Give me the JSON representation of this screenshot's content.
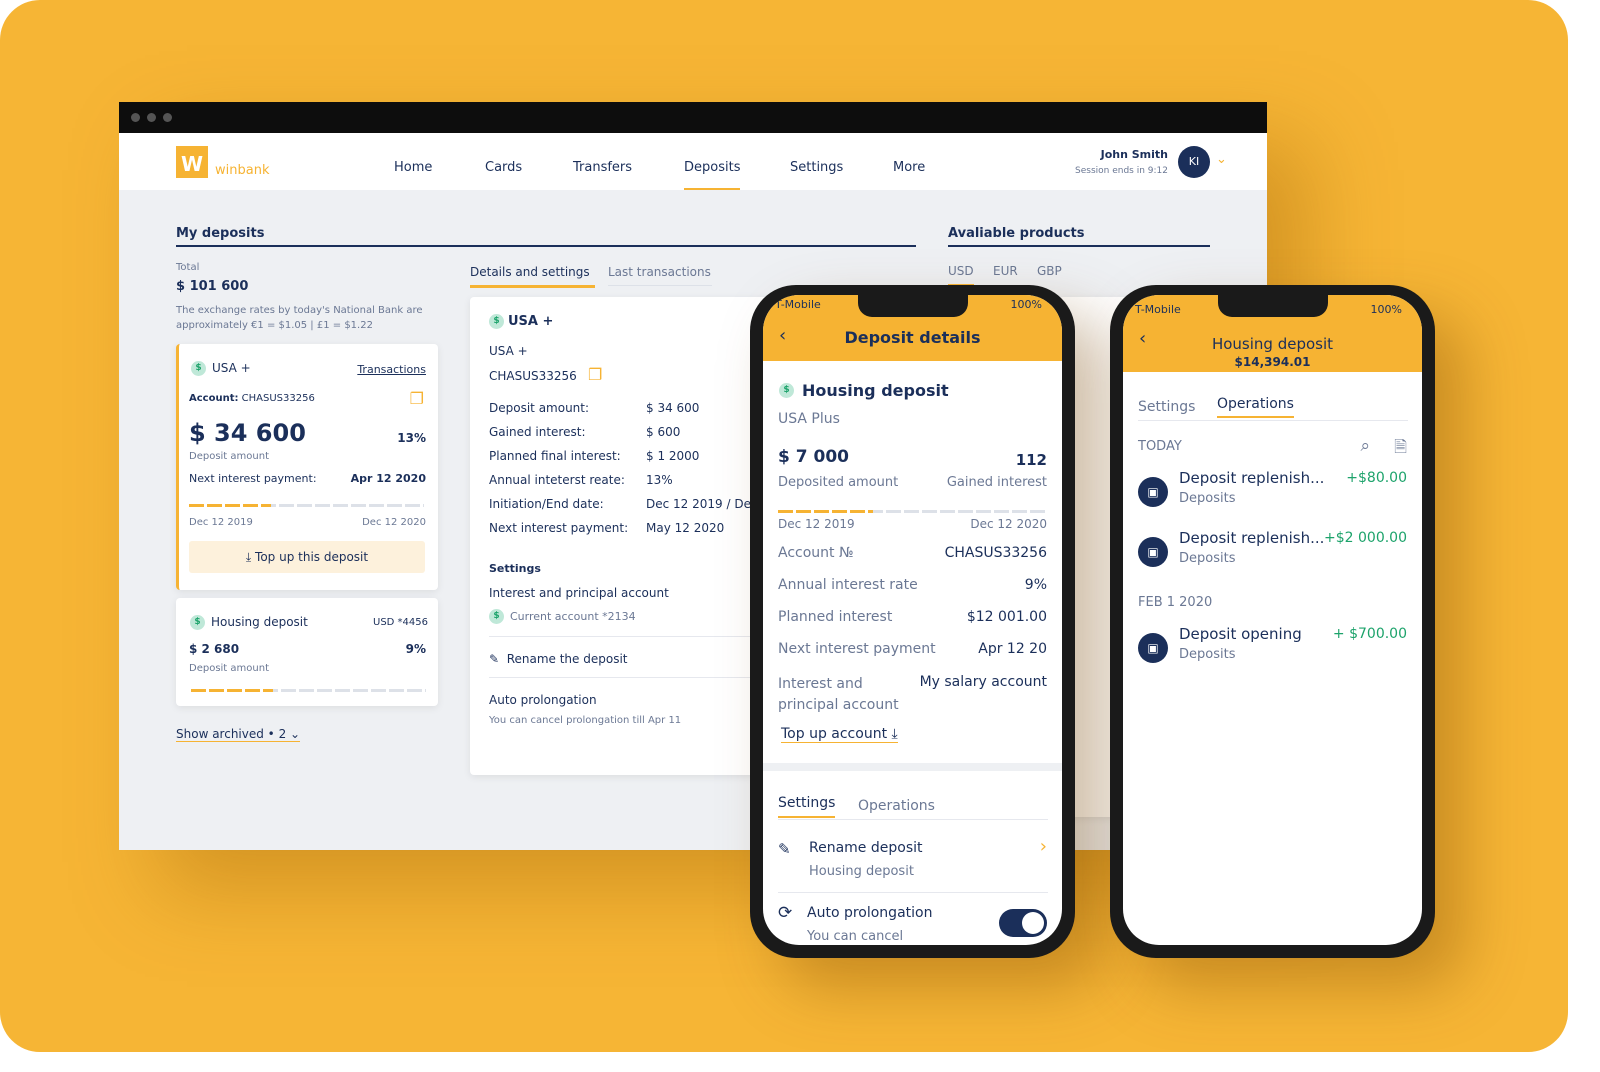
{
  "colors": {
    "background": "#f6b535",
    "accent": "#f6b333",
    "navy": "#1b2f5a",
    "positive": "#1da36b"
  },
  "nav": {
    "brand": "winbank",
    "logo_letter": "W",
    "items": [
      "Home",
      "Cards",
      "Transfers",
      "Deposits",
      "Settings",
      "More"
    ],
    "active": "Deposits",
    "user_name": "John Smith",
    "session": "Session ends in 9:12",
    "avatar": "KI"
  },
  "deposits": {
    "title": "My deposits",
    "total_label": "Total",
    "total": "$ 101 600",
    "rates_note": "The exchange rates by today's National Bank are approximately €1 = $1.05 | £1 = $1.22",
    "card1": {
      "name": "USA +",
      "transactions": "Transactions",
      "account_label": "Account:",
      "account": "CHASUS33256",
      "amount": "$ 34 600",
      "rate": "13%",
      "amount_label": "Deposit amount",
      "next_label": "Next interest payment:",
      "next": "Apr 12 2020",
      "start": "Dec 12 2019",
      "end": "Dec 12 2020",
      "progress": 0.35,
      "topup": "Top up this deposit"
    },
    "card2": {
      "name": "Housing deposit",
      "account": "USD *4456",
      "amount": "$ 2 680",
      "rate": "9%",
      "amount_label": "Deposit amount",
      "progress": 0.35
    },
    "show_archived": "Show archived • 2"
  },
  "details": {
    "tabs": [
      "Details and settings",
      "Last transactions"
    ],
    "active_tab": "Details and settings",
    "title": "USA +",
    "subtitle": "USA +",
    "account": "CHASUS33256",
    "rows": [
      [
        "Deposit amount:",
        "$ 34 600"
      ],
      [
        "Gained interest:",
        "$ 600"
      ],
      [
        "Planned final interest:",
        "$ 1 2000"
      ],
      [
        "Annual inteterst reate:",
        "13%"
      ],
      [
        "Initiation/End date:",
        "Dec 12 2019 / Dec"
      ],
      [
        "Next interest payment:",
        "May 12 2020"
      ]
    ],
    "settings_title": "Settings",
    "account_setting": "Interest and principal account",
    "current_account": "Current account *2134",
    "rename": "Rename the deposit",
    "auto": "Auto prolongation",
    "auto_note": "You can cancel prolongation till Apr 11"
  },
  "products": {
    "title": "Avaliable products",
    "currencies": [
      "USD",
      "EUR",
      "GBP"
    ],
    "active": "USD"
  },
  "phone1": {
    "carrier": "T-Mobile",
    "battery": "100%",
    "title": "Deposit details",
    "name": "Housing deposit",
    "product": "USA Plus",
    "amount": "$ 7 000",
    "amount_label": "Deposited amount",
    "interest": "112",
    "interest_label": "Gained interest",
    "start": "Dec 12 2019",
    "end": "Dec 12 2020",
    "progress": 0.35,
    "rows": [
      [
        "Account №",
        "CHASUS33256"
      ],
      [
        "Annual interest rate",
        "9%"
      ],
      [
        "Planned interest",
        "$12 001.00"
      ],
      [
        "Next interest payment",
        "Apr 12 20"
      ]
    ],
    "pa_label": "Interest and principal account",
    "pa_value": "My salary account",
    "topup": "Top up account",
    "tabs": [
      "Settings",
      "Operations"
    ],
    "active_tab": "Settings",
    "rename": "Rename deposit",
    "rename_sub": "Housing deposit",
    "auto": "Auto prolongation",
    "auto_sub": "You can cancel",
    "auto_on": true
  },
  "phone2": {
    "carrier": "T-Mobile",
    "battery": "100%",
    "title": "Housing deposit",
    "balance": "$14,394.01",
    "tabs": [
      "Settings",
      "Operations"
    ],
    "active_tab": "Operations",
    "groups": [
      {
        "date": "TODAY",
        "ops": [
          {
            "title": "Deposit replenish...",
            "sub": "Deposits",
            "amount": "+$80.00"
          },
          {
            "title": "Deposit replenish...",
            "sub": "Deposits",
            "amount": "+$2 000.00"
          }
        ]
      },
      {
        "date": "FEB 1 2020",
        "ops": [
          {
            "title": "Deposit opening",
            "sub": "Deposits",
            "amount": "+ $700.00"
          }
        ]
      }
    ]
  }
}
